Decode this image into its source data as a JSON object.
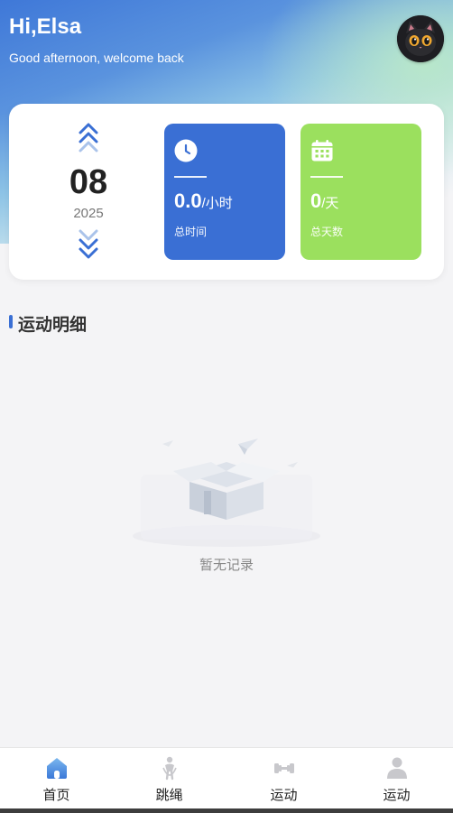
{
  "header": {
    "greeting": "Hi,Elsa",
    "subtitle": "Good afternoon, welcome back",
    "avatar_icon": "black-cat-avatar"
  },
  "summary_card": {
    "month": "08",
    "year": "2025",
    "up_icon": "double-chevron-up-icon",
    "down_icon": "double-chevron-down-icon",
    "stats": [
      {
        "icon": "clock-icon",
        "value": "0.0",
        "unit": "/小时",
        "label": "总时间",
        "color": "#3a6fd4"
      },
      {
        "icon": "calendar-icon",
        "value": "0",
        "unit": "/天",
        "label": "总天数",
        "color": "#9be05e"
      }
    ]
  },
  "section": {
    "title": "运动明细",
    "accent": "#3a6fd4"
  },
  "empty_state": {
    "icon": "empty-box-illustration",
    "text": "暂无记录"
  },
  "tabbar": {
    "active_color": "#4a86d8",
    "items": [
      {
        "label": "首页",
        "icon": "home-icon",
        "active": true
      },
      {
        "label": "跳绳",
        "icon": "jump-rope-icon",
        "active": false
      },
      {
        "label": "运动",
        "icon": "dumbbell-icon",
        "active": false
      },
      {
        "label": "运动",
        "icon": "user-icon",
        "active": false
      }
    ]
  }
}
